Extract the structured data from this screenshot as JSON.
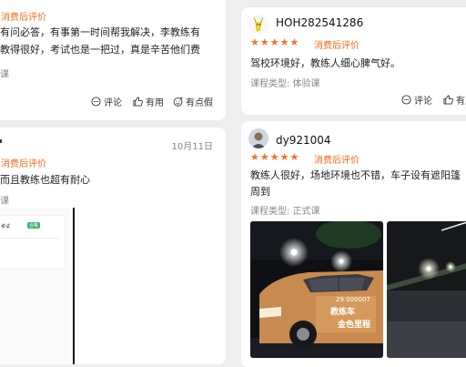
{
  "card1": {
    "tag": "消费后评价",
    "content_line1": "有问必答，有事第一时间帮我解决，李教练有",
    "content_line2": "教得很好，考试也是一把过，真是辛苦他们费",
    "meta_fragment": "课",
    "actions": {
      "comment": "评论",
      "useful": "有用",
      "funny": "有点假"
    }
  },
  "card2": {
    "username": "HOH282541286",
    "stars": "★★★★★",
    "tag": "消费后评价",
    "content": "驾校环境好，教练人细心脾气好。",
    "course_type": "课程类型: 体验课",
    "actions": {
      "comment": "评论",
      "useful": "有用"
    }
  },
  "card3": {
    "date": "10月11日",
    "tag": "消费后评价",
    "content": "而且教练也超有耐心",
    "meta_fragment": "课",
    "photo": {
      "label": "考试",
      "badge": "合格"
    }
  },
  "card4": {
    "username": "dy921004",
    "stars": "★★★★★",
    "tag": "消费后评价",
    "content_line1": "教练人很好，场地环境也不错，车子设有遮阳篷",
    "content_line2": "周到",
    "course_type": "课程类型: 正式课",
    "photo": {
      "plate_number": "29 000007",
      "car_label": "教练车",
      "car_slogan": "金色里程"
    }
  },
  "colors": {
    "accent": "#f26b1d",
    "star": "#ff6a2a",
    "background": "#eeeeee"
  }
}
